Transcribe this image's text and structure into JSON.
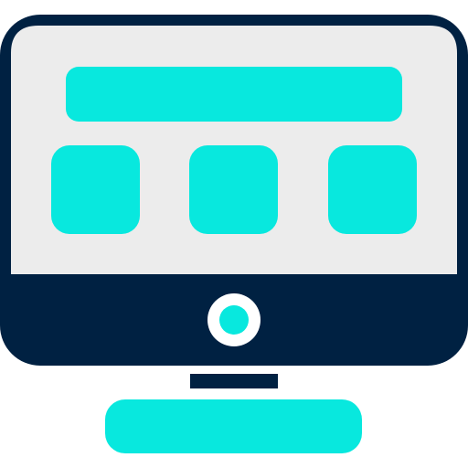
{
  "colors": {
    "outline": "#002142",
    "accent": "#08E8DE",
    "screen": "#ECECEC",
    "background": "#FFFFFF"
  },
  "icon": {
    "name": "desktop-monitor-icon",
    "parts": [
      "monitor-frame",
      "screen",
      "header-bar",
      "tile-left",
      "tile-center",
      "tile-right",
      "bezel",
      "power-button",
      "stand-neck",
      "stand-base"
    ]
  }
}
